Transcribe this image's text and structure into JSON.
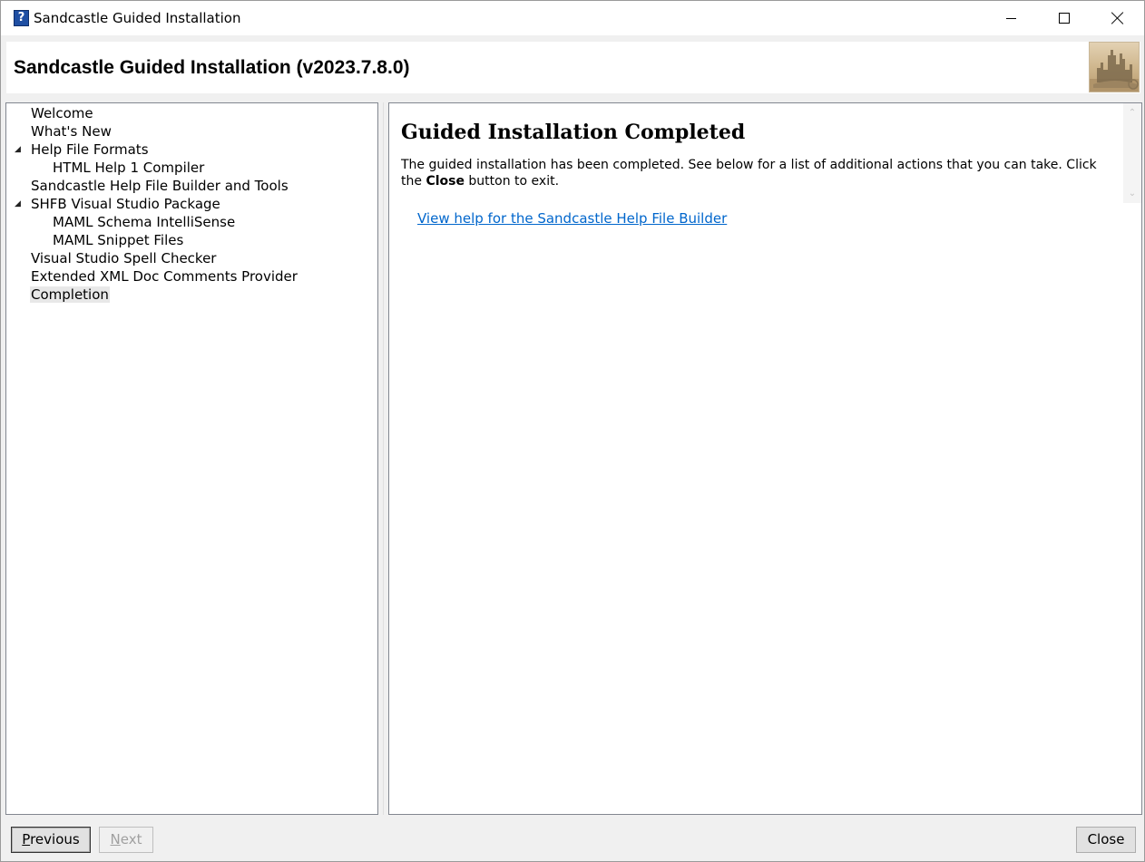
{
  "window": {
    "title": "Sandcastle Guided Installation",
    "app_icon_glyph": "?",
    "controls": {
      "minimize": "minimize-icon",
      "maximize": "maximize-icon",
      "close": "close-icon"
    }
  },
  "header": {
    "title": "Sandcastle Guided Installation (v2023.7.8.0)",
    "logo": "sandcastle-logo"
  },
  "tree": {
    "items": [
      {
        "label": "Welcome",
        "level": 0,
        "expanded": null,
        "selected": false
      },
      {
        "label": "What's New",
        "level": 0,
        "expanded": null,
        "selected": false
      },
      {
        "label": "Help File Formats",
        "level": 0,
        "expanded": true,
        "selected": false
      },
      {
        "label": "HTML Help 1 Compiler",
        "level": 1,
        "expanded": null,
        "selected": false
      },
      {
        "label": "Sandcastle Help File Builder and Tools",
        "level": 0,
        "expanded": null,
        "selected": false
      },
      {
        "label": "SHFB Visual Studio Package",
        "level": 0,
        "expanded": true,
        "selected": false
      },
      {
        "label": "MAML Schema IntelliSense",
        "level": 1,
        "expanded": null,
        "selected": false
      },
      {
        "label": "MAML Snippet Files",
        "level": 1,
        "expanded": null,
        "selected": false
      },
      {
        "label": "Visual Studio Spell Checker",
        "level": 0,
        "expanded": null,
        "selected": false
      },
      {
        "label": "Extended XML Doc Comments Provider",
        "level": 0,
        "expanded": null,
        "selected": false
      },
      {
        "label": "Completion",
        "level": 0,
        "expanded": null,
        "selected": true
      }
    ],
    "expander_glyph": "◢"
  },
  "content": {
    "title": "Guided Installation Completed",
    "text_before": "The guided installation has been completed. See below for a list of additional actions that you can take. Click the ",
    "text_bold": "Close",
    "text_after": " button to exit.",
    "link": "View help for the Sandcastle Help File Builder",
    "scroll_up_glyph": "⌃",
    "scroll_down_glyph": "⌄"
  },
  "footer": {
    "previous": {
      "accel": "P",
      "rest": "revious",
      "enabled": true
    },
    "next": {
      "accel": "N",
      "rest": "ext",
      "enabled": false
    },
    "close": "Close"
  }
}
